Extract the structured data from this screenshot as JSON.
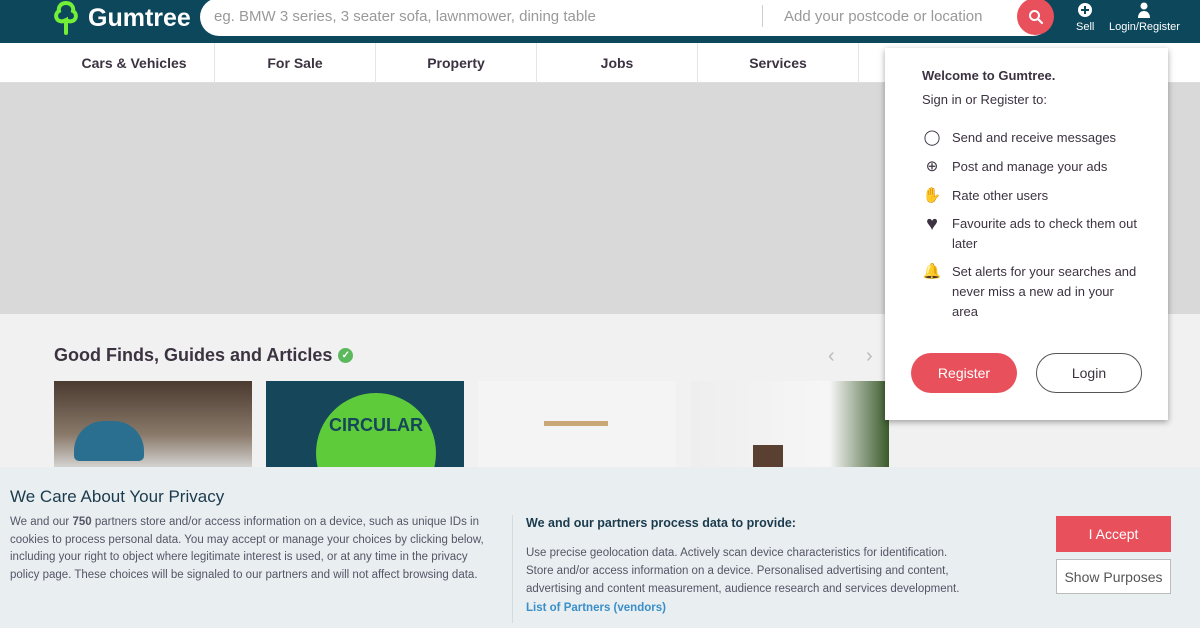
{
  "header": {
    "logo": "Gumtree",
    "search_placeholder": "eg. BMW 3 series, 3 seater sofa, lawnmower, dining table",
    "location_placeholder": "Add your postcode or location",
    "sell": "Sell",
    "login": "Login/Register"
  },
  "nav": [
    "Cars & Vehicles",
    "For Sale",
    "Property",
    "Jobs",
    "Services"
  ],
  "section": {
    "title": "Good Finds, Guides and Articles",
    "card_text": "CIRCULAR"
  },
  "dropdown": {
    "title": "Welcome to Gumtree.",
    "subtitle": "Sign in or Register to:",
    "benefits": [
      {
        "icon": "chat-icon",
        "text": "Send and receive messages"
      },
      {
        "icon": "post-ad-icon",
        "text": "Post and manage your ads"
      },
      {
        "icon": "rate-icon",
        "text": "Rate other users"
      },
      {
        "icon": "heart-icon",
        "text": "Favourite ads to check them out later"
      },
      {
        "icon": "bell-icon",
        "text": "Set alerts for your searches and never miss a new ad in your area"
      }
    ],
    "register": "Register",
    "login": "Login"
  },
  "privacy": {
    "title": "We Care About Your Privacy",
    "p1_a": "We and our ",
    "p1_num": "750",
    "p1_b": " partners store and/or access information on a device, such as unique IDs in cookies to process personal data. You may accept or manage your choices by clicking below, including your right to object where legitimate interest is used, or at any time in the privacy policy page. These choices will be signaled to our partners and will not affect browsing data.",
    "h2": "We and our partners process data to provide:",
    "p2": "Use precise geolocation data. Actively scan device characteristics for identification. Store and/or access information on a device. Personalised advertising and content, advertising and content measurement, audience research and services development.",
    "link": "List of Partners (vendors)",
    "accept": "I Accept",
    "purposes": "Show Purposes"
  },
  "colors": {
    "header": "#0d475c",
    "accent": "#e8505b",
    "logo_green": "#72ef36"
  }
}
